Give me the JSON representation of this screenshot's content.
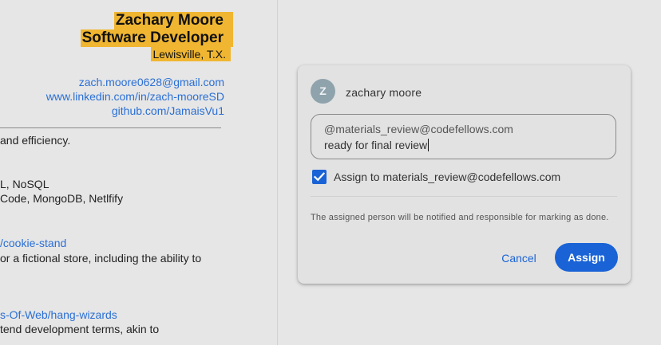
{
  "document": {
    "name": "Zachary Moore",
    "title": "Software Developer",
    "location": "Lewisville, T.X.",
    "links": [
      "zach.moore0628@gmail.com",
      "www.linkedin.com/in/zach-mooreSD",
      "github.com/JamaisVu1"
    ],
    "lines": [
      {
        "text": "and efficiency.",
        "kind": "text"
      },
      {
        "text": "L, NoSQL",
        "kind": "text"
      },
      {
        "text": "Code, MongoDB, Netlfify",
        "kind": "text"
      },
      {
        "text": "/cookie-stand",
        "kind": "link"
      },
      {
        "text": "or a fictional store, including the ability to",
        "kind": "text"
      },
      {
        "text": "s-Of-Web/hang-wizards",
        "kind": "link"
      },
      {
        "text": "tend development terms, akin to",
        "kind": "text"
      }
    ]
  },
  "dialog": {
    "avatar_letter": "Z",
    "user_name": "zachary moore",
    "input_line1": "@materials_review@codefellows.com",
    "input_line2": "ready for final review",
    "assign_checked": true,
    "assign_label": "Assign to materials_review@codefellows.com",
    "note": "The assigned person will be notified and responsible for marking as done.",
    "cancel_label": "Cancel",
    "assign_label_button": "Assign"
  },
  "colors": {
    "highlight": "#f0b631",
    "accent": "#1a63d6",
    "link": "#2a6fd6"
  }
}
